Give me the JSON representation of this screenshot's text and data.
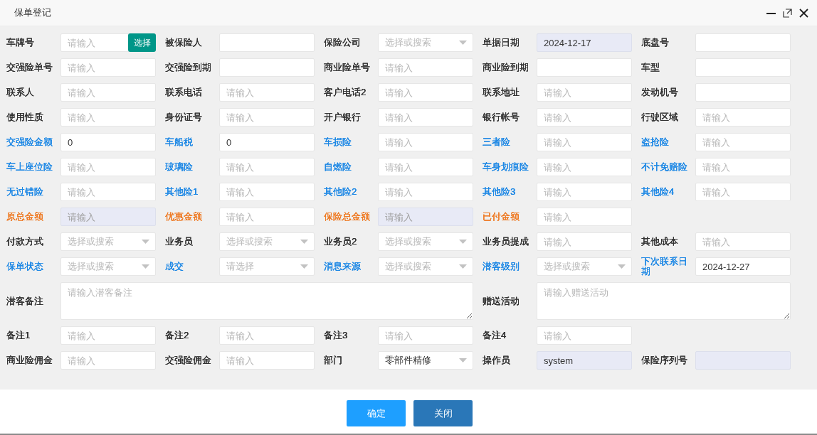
{
  "window": {
    "title": "保单登记"
  },
  "rows": [
    {
      "items": [
        {
          "label": "车牌号",
          "color": "#333333",
          "field": {
            "kind": "input-button",
            "placeholder": "请输入",
            "button": "选择",
            "disabled": false
          }
        },
        {
          "label": "被保险人",
          "color": "#333333",
          "field": {
            "kind": "input",
            "disabled": false
          }
        },
        {
          "label": "保险公司",
          "color": "#333333",
          "field": {
            "kind": "select",
            "placeholder": "选择或搜索",
            "disabled": false
          }
        },
        {
          "label": "单据日期",
          "color": "#333333",
          "field": {
            "kind": "input",
            "value": "2024-12-17",
            "disabled": true
          }
        },
        {
          "label": "底盘号",
          "color": "#333333",
          "field": {
            "kind": "input",
            "disabled": false
          }
        }
      ]
    },
    {
      "items": [
        {
          "label": "交强险单号",
          "color": "#333333",
          "field": {
            "kind": "input",
            "placeholder": "请输入",
            "disabled": false
          }
        },
        {
          "label": "交强险到期",
          "color": "#333333",
          "field": {
            "kind": "input",
            "disabled": false
          }
        },
        {
          "label": "商业险单号",
          "color": "#333333",
          "field": {
            "kind": "input",
            "placeholder": "请输入",
            "disabled": false
          }
        },
        {
          "label": "商业险到期",
          "color": "#333333",
          "field": {
            "kind": "input",
            "disabled": false
          }
        },
        {
          "label": "车型",
          "color": "#333333",
          "field": {
            "kind": "input",
            "disabled": false
          }
        }
      ]
    },
    {
      "items": [
        {
          "label": "联系人",
          "color": "#333333",
          "field": {
            "kind": "input",
            "placeholder": "请输入",
            "disabled": false
          }
        },
        {
          "label": "联系电话",
          "color": "#333333",
          "field": {
            "kind": "input",
            "placeholder": "请输入",
            "disabled": false
          }
        },
        {
          "label": "客户电话2",
          "color": "#333333",
          "field": {
            "kind": "input",
            "placeholder": "请输入",
            "disabled": false
          }
        },
        {
          "label": "联系地址",
          "color": "#333333",
          "field": {
            "kind": "input",
            "placeholder": "请输入",
            "disabled": false
          }
        },
        {
          "label": "发动机号",
          "color": "#333333",
          "field": {
            "kind": "input",
            "disabled": false
          }
        }
      ]
    },
    {
      "items": [
        {
          "label": "使用性质",
          "color": "#333333",
          "field": {
            "kind": "input",
            "placeholder": "请输入",
            "disabled": false
          }
        },
        {
          "label": "身份证号",
          "color": "#333333",
          "field": {
            "kind": "input",
            "placeholder": "请输入",
            "disabled": false
          }
        },
        {
          "label": "开户银行",
          "color": "#333333",
          "field": {
            "kind": "input",
            "placeholder": "请输入",
            "disabled": false
          }
        },
        {
          "label": "银行帐号",
          "color": "#333333",
          "field": {
            "kind": "input",
            "placeholder": "请输入",
            "disabled": false
          }
        },
        {
          "label": "行驶区域",
          "color": "#333333",
          "field": {
            "kind": "input",
            "placeholder": "请输入",
            "disabled": false
          }
        }
      ]
    },
    {
      "items": [
        {
          "label": "交强险金额",
          "color": "#1e88e5",
          "field": {
            "kind": "input",
            "value": "0",
            "disabled": false
          }
        },
        {
          "label": "车船税",
          "color": "#1e88e5",
          "field": {
            "kind": "input",
            "value": "0",
            "disabled": false
          }
        },
        {
          "label": "车损险",
          "color": "#1e88e5",
          "field": {
            "kind": "input",
            "placeholder": "请输入",
            "disabled": false
          }
        },
        {
          "label": "三者险",
          "color": "#1e88e5",
          "field": {
            "kind": "input",
            "placeholder": "请输入",
            "disabled": false
          }
        },
        {
          "label": "盗抢险",
          "color": "#1e88e5",
          "field": {
            "kind": "input",
            "placeholder": "请输入",
            "disabled": false
          }
        }
      ]
    },
    {
      "items": [
        {
          "label": "车上座位险",
          "color": "#1e88e5",
          "field": {
            "kind": "input",
            "placeholder": "请输入",
            "disabled": false
          }
        },
        {
          "label": "玻璃险",
          "color": "#1e88e5",
          "field": {
            "kind": "input",
            "placeholder": "请输入",
            "disabled": false
          }
        },
        {
          "label": "自燃险",
          "color": "#1e88e5",
          "field": {
            "kind": "input",
            "placeholder": "请输入",
            "disabled": false
          }
        },
        {
          "label": "车身划痕险",
          "color": "#1e88e5",
          "field": {
            "kind": "input",
            "placeholder": "请输入",
            "disabled": false
          }
        },
        {
          "label": "不计免赔险",
          "color": "#1e88e5",
          "field": {
            "kind": "input",
            "placeholder": "请输入",
            "disabled": false
          }
        }
      ]
    },
    {
      "items": [
        {
          "label": "无过错险",
          "color": "#1e88e5",
          "field": {
            "kind": "input",
            "placeholder": "请输入",
            "disabled": false
          }
        },
        {
          "label": "其他险1",
          "color": "#1e88e5",
          "field": {
            "kind": "input",
            "placeholder": "请输入",
            "disabled": false
          }
        },
        {
          "label": "其他险2",
          "color": "#1e88e5",
          "field": {
            "kind": "input",
            "placeholder": "请输入",
            "disabled": false
          }
        },
        {
          "label": "其他险3",
          "color": "#1e88e5",
          "field": {
            "kind": "input",
            "placeholder": "请输入",
            "disabled": false
          }
        },
        {
          "label": "其他险4",
          "color": "#1e88e5",
          "field": {
            "kind": "input",
            "placeholder": "请输入",
            "disabled": false
          }
        }
      ]
    },
    {
      "items": [
        {
          "label": "原总金额",
          "color": "#ee7b25",
          "field": {
            "kind": "input",
            "placeholder": "请输入",
            "disabled": true
          }
        },
        {
          "label": "优惠金额",
          "color": "#ee7b25",
          "field": {
            "kind": "input",
            "placeholder": "请输入",
            "disabled": false
          }
        },
        {
          "label": "保险总金额",
          "color": "#ee7b25",
          "field": {
            "kind": "input",
            "placeholder": "请输入",
            "disabled": true
          }
        },
        {
          "label": "已付金额",
          "color": "#ee7b25",
          "field": {
            "kind": "input",
            "placeholder": "请输入",
            "disabled": false
          }
        }
      ]
    },
    {
      "items": [
        {
          "label": "付款方式",
          "color": "#333333",
          "field": {
            "kind": "select",
            "placeholder": "选择或搜索",
            "disabled": false
          }
        },
        {
          "label": "业务员",
          "color": "#333333",
          "field": {
            "kind": "select",
            "placeholder": "选择或搜索",
            "disabled": false
          }
        },
        {
          "label": "业务员2",
          "color": "#333333",
          "field": {
            "kind": "select",
            "placeholder": "选择或搜索",
            "disabled": false
          }
        },
        {
          "label": "业务员提成",
          "color": "#333333",
          "field": {
            "kind": "input",
            "placeholder": "请输入",
            "disabled": false
          }
        },
        {
          "label": "其他成本",
          "color": "#333333",
          "field": {
            "kind": "input",
            "placeholder": "请输入",
            "disabled": false
          }
        }
      ]
    },
    {
      "items": [
        {
          "label": "保单状态",
          "color": "#1e88e5",
          "field": {
            "kind": "select",
            "placeholder": "选择或搜索",
            "disabled": false
          }
        },
        {
          "label": "成交",
          "color": "#1e88e5",
          "field": {
            "kind": "select",
            "placeholder": "请选择",
            "disabled": false
          }
        },
        {
          "label": "消息来源",
          "color": "#1e88e5",
          "field": {
            "kind": "select",
            "placeholder": "选择或搜索",
            "disabled": false
          }
        },
        {
          "label": "潜客级别",
          "color": "#1e88e5",
          "field": {
            "kind": "select",
            "placeholder": "选择或搜索",
            "disabled": false
          }
        },
        {
          "label": "下次联系日期",
          "color": "#1e88e5",
          "field": {
            "kind": "input",
            "value": "2024-12-27",
            "disabled": false
          }
        }
      ]
    },
    {
      "items": [
        {
          "label": "潜客备注",
          "color": "#333333",
          "field": {
            "kind": "textarea",
            "placeholder": "请输入潜客备注",
            "disabled": false
          }
        },
        {
          "label": "赠送活动",
          "color": "#333333",
          "field": {
            "kind": "textarea",
            "placeholder": "请输入赠送活动",
            "disabled": false
          }
        }
      ]
    },
    {
      "items": [
        {
          "label": "备注1",
          "color": "#333333",
          "field": {
            "kind": "input",
            "placeholder": "请输入",
            "disabled": false
          }
        },
        {
          "label": "备注2",
          "color": "#333333",
          "field": {
            "kind": "input",
            "placeholder": "请输入",
            "disabled": false
          }
        },
        {
          "label": "备注3",
          "color": "#333333",
          "field": {
            "kind": "input",
            "placeholder": "请输入",
            "disabled": false
          }
        },
        {
          "label": "备注4",
          "color": "#333333",
          "field": {
            "kind": "input",
            "placeholder": "请输入",
            "disabled": false
          }
        }
      ]
    },
    {
      "items": [
        {
          "label": "商业险佣金",
          "color": "#333333",
          "field": {
            "kind": "input",
            "placeholder": "请输入",
            "disabled": false
          }
        },
        {
          "label": "交强险佣金",
          "color": "#333333",
          "field": {
            "kind": "input",
            "placeholder": "请输入",
            "disabled": false
          }
        },
        {
          "label": "部门",
          "color": "#333333",
          "field": {
            "kind": "select",
            "value": "零部件精修",
            "disabled": false
          }
        },
        {
          "label": "操作员",
          "color": "#333333",
          "field": {
            "kind": "input",
            "value": "system",
            "disabled": true
          }
        },
        {
          "label": "保险序列号",
          "color": "#333333",
          "field": {
            "kind": "input",
            "disabled": true
          }
        }
      ]
    }
  ],
  "buttons": [
    {
      "label": "确定",
      "kind": "primary"
    },
    {
      "label": "关闭",
      "kind": "secondary"
    }
  ]
}
